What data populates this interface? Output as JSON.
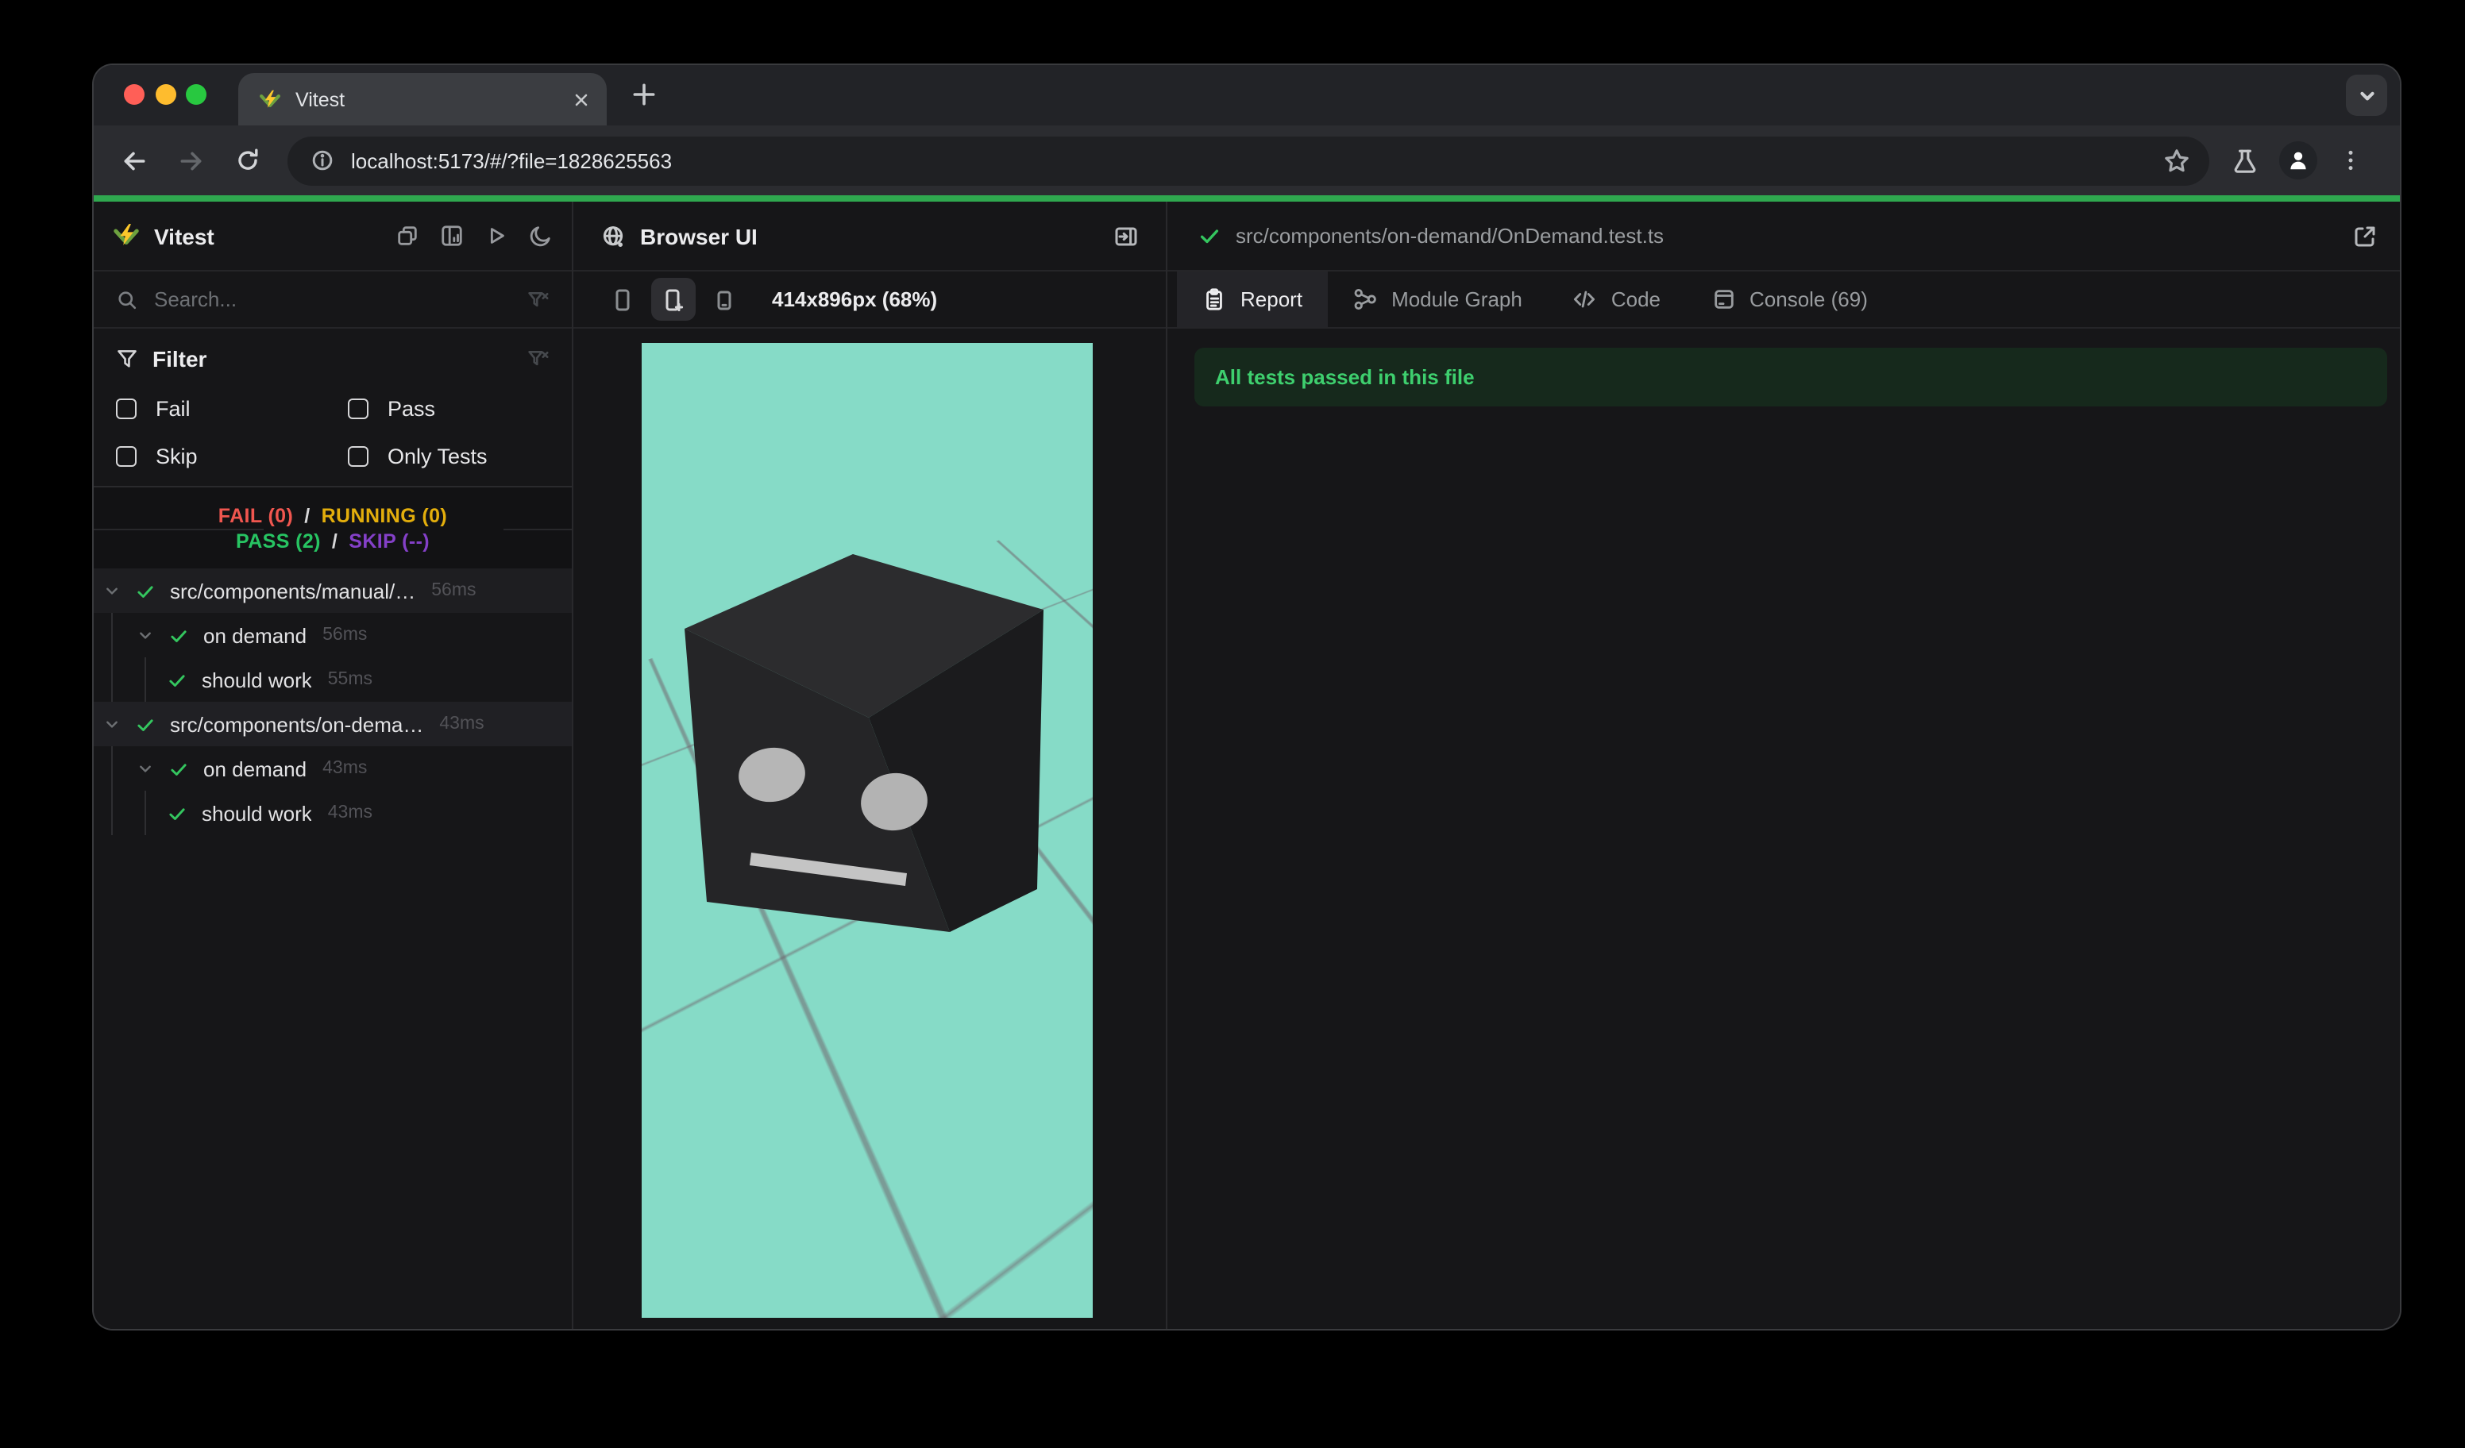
{
  "chrome": {
    "tab": {
      "title": "Vitest",
      "favicon": "vitest-logo-icon",
      "close_icon": "close-icon"
    },
    "new_tab_icon": "plus-icon",
    "tab_search_icon": "chevron-down-icon",
    "toolbar": {
      "back_icon": "back-arrow-icon",
      "forward_icon": "forward-arrow-icon",
      "reload_icon": "reload-icon",
      "site_info_icon": "info-icon",
      "url": "localhost:5173/#/?file=1828625563",
      "bookmark_icon": "star-icon",
      "right_icons": [
        "flask-icon",
        "profile-icon",
        "menu-icon"
      ]
    },
    "traffic_lights": {
      "close": "#ff5f57",
      "minimize": "#febc2e",
      "maximize": "#28c840"
    },
    "progress_color": "#2fa84f"
  },
  "sidebar": {
    "title": "Vitest",
    "header_icons": [
      "collapse-windows-icon",
      "dashboard-icon",
      "run-all-icon",
      "dark-mode-icon"
    ],
    "search": {
      "placeholder": "Search...",
      "icons": [
        "search-icon",
        "clear-filter-icon"
      ]
    },
    "filter": {
      "title": "Filter",
      "options": [
        {
          "label": "Fail",
          "checked": false
        },
        {
          "label": "Pass",
          "checked": false
        },
        {
          "label": "Skip",
          "checked": false
        },
        {
          "label": "Only Tests",
          "checked": false
        }
      ]
    },
    "summary": {
      "line1": [
        {
          "text": "FAIL (0)",
          "color": "#f0564f"
        },
        {
          "text": "/",
          "color": "#d6d6d8"
        },
        {
          "text": "RUNNING (0)",
          "color": "#e3ae0c"
        }
      ],
      "line2": [
        {
          "text": "PASS (2)",
          "color": "#27c462"
        },
        {
          "text": "/",
          "color": "#d6d6d8"
        },
        {
          "text": "SKIP (--)",
          "color": "#8440c8"
        }
      ]
    },
    "tree": [
      {
        "label": "src/components/manual/…",
        "duration": "56ms",
        "level": 0,
        "type": "file",
        "expandable": true,
        "status": "pass",
        "selected": false
      },
      {
        "label": "on demand",
        "duration": "56ms",
        "level": 1,
        "type": "suite",
        "expandable": true,
        "status": "pass",
        "selected": false
      },
      {
        "label": "should work",
        "duration": "55ms",
        "level": 2,
        "type": "test",
        "expandable": false,
        "status": "pass",
        "selected": false
      },
      {
        "label": "src/components/on-dema…",
        "duration": "43ms",
        "level": 0,
        "type": "file",
        "expandable": true,
        "status": "pass",
        "selected": true
      },
      {
        "label": "on demand",
        "duration": "43ms",
        "level": 1,
        "type": "suite",
        "expandable": true,
        "status": "pass",
        "selected": false
      },
      {
        "label": "should work",
        "duration": "43ms",
        "level": 2,
        "type": "test",
        "expandable": false,
        "status": "pass",
        "selected": false
      }
    ]
  },
  "browser_panel": {
    "title": "Browser UI",
    "title_icon": "globe-icon",
    "expand_icon": "panel-expand-icon",
    "device_buttons": [
      {
        "icon": "phone-icon",
        "active": false
      },
      {
        "icon": "phone-add-icon",
        "active": true
      },
      {
        "icon": "phone-small-icon",
        "active": false
      }
    ],
    "viewport_label": "414x896px (68%)",
    "viewport_bg": "#86dbc7"
  },
  "report_panel": {
    "status_icon": "check-icon",
    "file_path": "src/components/on-demand/OnDemand.test.ts",
    "open_external_icon": "external-link-icon",
    "tabs": [
      {
        "label": "Report",
        "icon": "clipboard",
        "active": true
      },
      {
        "label": "Module Graph",
        "icon": "graph",
        "active": false
      },
      {
        "label": "Code",
        "icon": "code",
        "active": false
      },
      {
        "label": "Console (69)",
        "icon": "console",
        "active": false
      }
    ],
    "banner": "All tests passed in this file"
  },
  "colors": {
    "pass_green": "#34c65f",
    "banner_bg": "#16291c",
    "banner_text": "#3ecf6e",
    "accent_progress": "#2fa84f",
    "viewport_teal": "#86dbc7"
  }
}
